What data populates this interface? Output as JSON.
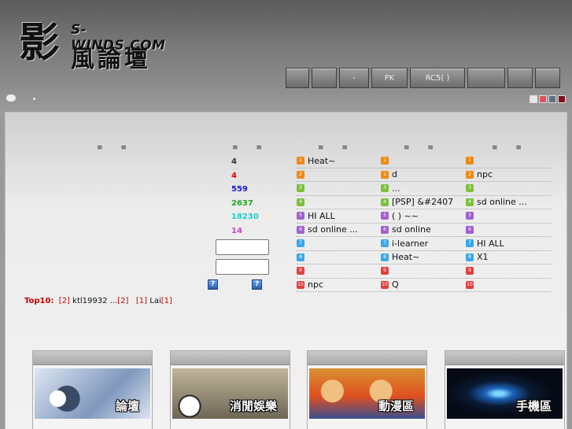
{
  "logo": {
    "main_glyph": "影",
    "domain": "S-WINDS.COM",
    "chinese": "風論壇"
  },
  "nav": {
    "buttons": [
      {
        "label": "",
        "w": 30
      },
      {
        "label": "",
        "w": 32
      },
      {
        "label": "-",
        "w": 38
      },
      {
        "label": "PK",
        "w": 46
      },
      {
        "label": "RC5( )",
        "w": 70
      },
      {
        "label": "",
        "w": 48
      },
      {
        "label": "",
        "w": 32
      },
      {
        "label": "",
        "w": 32
      }
    ]
  },
  "swatch_colors": [
    "#e8e8e8",
    "#e05060",
    "#607080",
    "#801020"
  ],
  "headers": [
    "≡ ≡",
    "≡ ≡",
    "≡ ≡",
    "≡ ≡",
    "≡ ≡"
  ],
  "stats": [
    {
      "value": "4",
      "color": "#333333"
    },
    {
      "value": "4",
      "color": "#dd0000"
    },
    {
      "value": "559",
      "color": "#1a1acc"
    },
    {
      "value": "2637",
      "color": "#22aa22"
    },
    {
      "value": "18230",
      "color": "#22cccc"
    },
    {
      "value": "14",
      "color": "#cc44cc"
    }
  ],
  "rank_colors": [
    "#f08a10",
    "#f08a10",
    "#7cc03c",
    "#7cc03c",
    "#a060d0",
    "#a060d0",
    "#3aa8e8",
    "#3aa8e8",
    "#e04040",
    "#e04040"
  ],
  "rankings": [
    [
      "Heat~",
      "",
      "",
      "",
      "HI ALL",
      "sd online ...",
      "",
      "",
      "",
      "npc",
      "X1"
    ],
    [
      "",
      "d",
      "...",
      "[PSP] &#2407",
      "( ) ~~",
      "sd online",
      "i-learner",
      "Heat~",
      "",
      "Q"
    ],
    [
      "",
      "npc",
      "",
      "sd online ...",
      "",
      "",
      "HI ALL",
      "X1",
      ""
    ]
  ],
  "top10": {
    "label": "Top10:",
    "n1": "[2]",
    "user1": "ktl19932 ...",
    "n2": "[2]",
    "n3": "[1]",
    "user2": "Lai",
    "n4": "[1]"
  },
  "cards": [
    {
      "label": "論壇",
      "theme": "forum"
    },
    {
      "label": "消閒娛樂",
      "theme": "leisure"
    },
    {
      "label": "動漫區",
      "theme": "anime"
    },
    {
      "label": "手機區",
      "theme": "mobile"
    }
  ]
}
